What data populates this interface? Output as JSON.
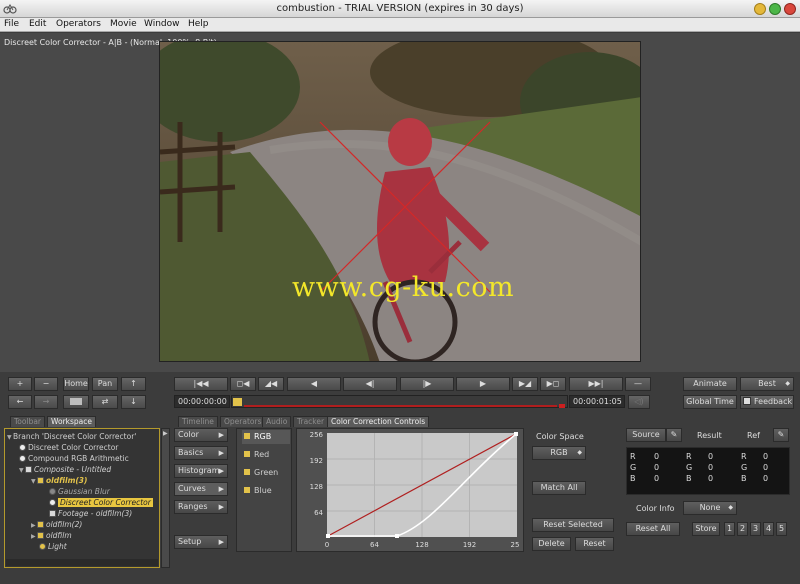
{
  "window": {
    "title": "combustion - TRIAL VERSION (expires in 30 days)"
  },
  "menu": [
    "File",
    "Edit",
    "Operators",
    "Movie",
    "Window",
    "Help"
  ],
  "viewer": {
    "label": "Discreet Color Corrector - A|B - (Normal, 100%, 8 Bit)",
    "watermark": "www.cg-ku.com"
  },
  "toolbar": {
    "plus": "+",
    "minus": "−",
    "home": "Home",
    "pan": "Pan",
    "back": "←",
    "forward": "→",
    "up": "↑",
    "down": "↓"
  },
  "transport": {
    "buttons": [
      "|◀◀",
      "◻◀",
      "◢◀",
      "◀",
      "◀|",
      "|▶",
      "▶",
      "▶◢",
      "▶◻",
      "▶▶|",
      "—"
    ],
    "time_start": "00:00:00:00",
    "time_end": "00:00:01:05"
  },
  "right_controls": {
    "animate": "Animate",
    "quality": "Best",
    "global_time": "Global Time",
    "feedback": "Feedback"
  },
  "panel_tabs_left": [
    "Toolbar",
    "Workspace"
  ],
  "panel_tabs_right": [
    "Timeline",
    "Operators",
    "Audio",
    "Tracker",
    "Color Correction Controls"
  ],
  "workspace_tree": [
    "Branch 'Discreet Color Corrector'",
    "Discreet Color Corrector",
    "Compound RGB Arithmetic",
    "Composite - Untitled",
    "oldfilm(3)",
    "Gaussian Blur",
    "Discreet Color Corrector",
    "Footage - oldfilm(3)",
    "oldfilm(2)",
    "oldfilm",
    "Light"
  ],
  "cc_categories": [
    "Color",
    "Basics",
    "Histogram",
    "Curves",
    "Ranges",
    "Setup"
  ],
  "channels": [
    "RGB",
    "Red",
    "Green",
    "Blue"
  ],
  "curve": {
    "y_ticks": [
      "256",
      "192",
      "128",
      "64"
    ],
    "x_ticks": [
      "0",
      "64",
      "128",
      "192",
      "25"
    ]
  },
  "color_space": {
    "label": "Color Space",
    "value": "RGB"
  },
  "actions": {
    "match_all": "Match All",
    "reset_selected": "Reset Selected",
    "delete": "Delete",
    "reset": "Reset"
  },
  "color_matrix": {
    "source": "Source",
    "result": "Result",
    "ref": "Ref",
    "rows": [
      {
        "ch": "R",
        "v": "0"
      },
      {
        "ch": "G",
        "v": "0"
      },
      {
        "ch": "B",
        "v": "0"
      }
    ]
  },
  "color_info": {
    "label": "Color Info",
    "value": "None"
  },
  "bottom": {
    "reset_all": "Reset All",
    "store": "Store",
    "slots": [
      "1",
      "2",
      "3",
      "4",
      "5"
    ]
  },
  "colors": {
    "accent": "#e2c24a",
    "curve_white": "#ffffff",
    "curve_red": "#b02020",
    "progress_red": "#cc1f1f"
  }
}
